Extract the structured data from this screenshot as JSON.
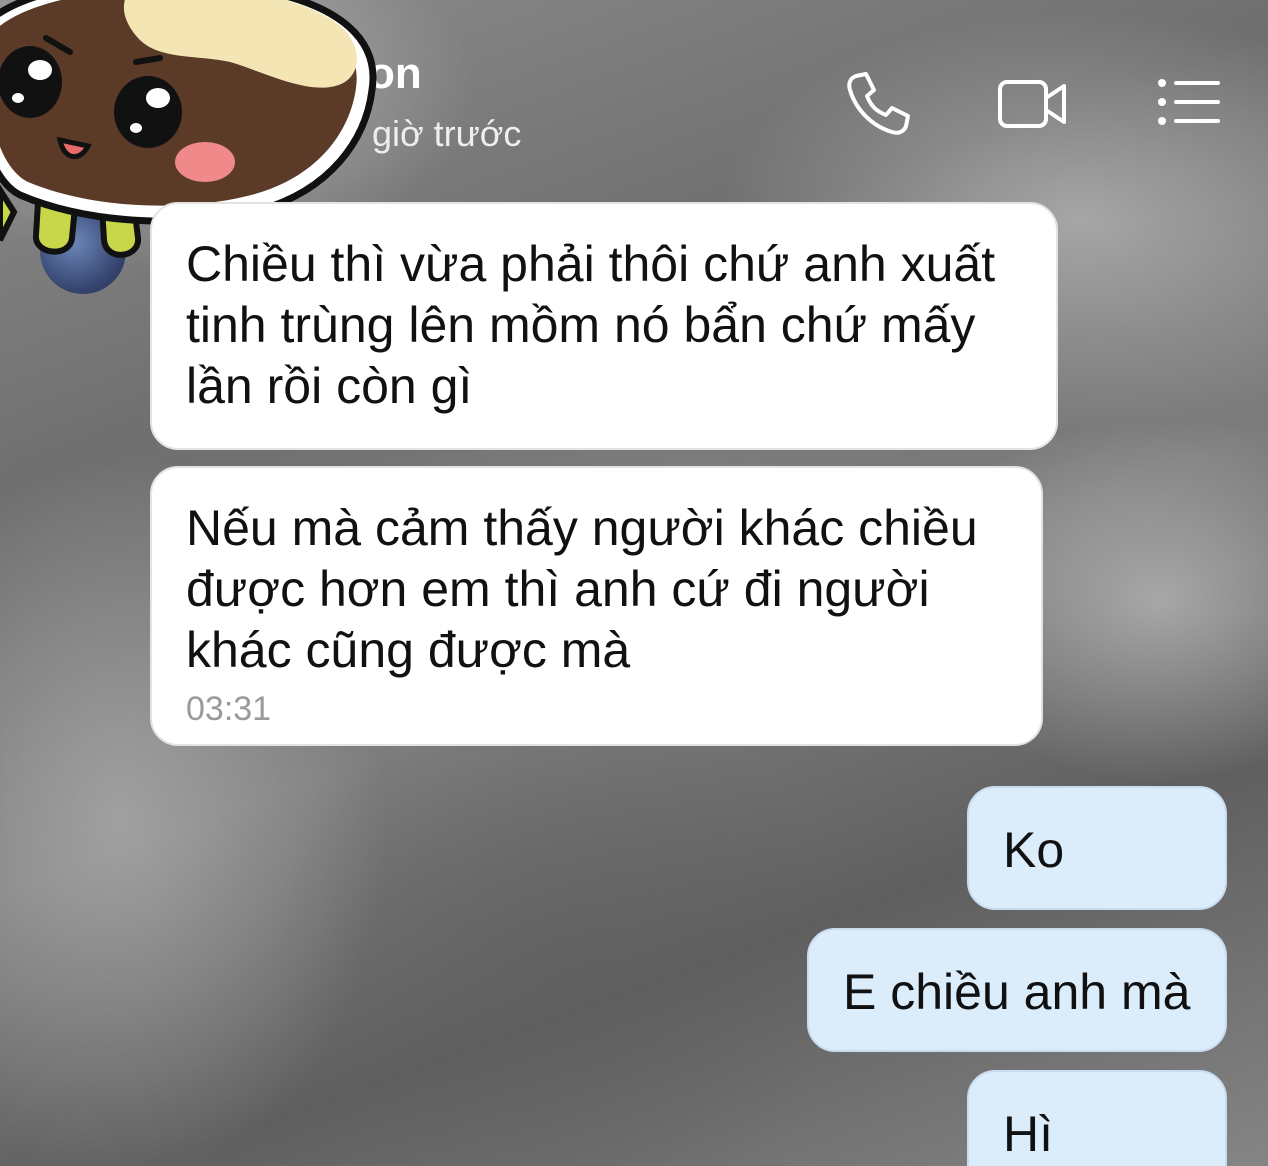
{
  "header": {
    "contact_name_visible": "on",
    "last_seen_visible": "giờ trước",
    "icons": {
      "call": "phone-icon",
      "video": "video-camera-icon",
      "menu": "list-menu-icon"
    }
  },
  "messages": [
    {
      "direction": "received",
      "text": "Chiều thì vừa phải thôi chứ anh xuất tinh trùng lên mồm nó bẩn chứ mấy lần rồi còn gì"
    },
    {
      "direction": "received",
      "text": "Nếu mà cảm thấy người khác chiều được hơn em thì anh cứ đi người khác cũng được mà",
      "time": "03:31"
    },
    {
      "direction": "sent",
      "text": "Ko"
    },
    {
      "direction": "sent",
      "text": "E chiều anh mà"
    },
    {
      "direction": "sent",
      "text": "Hì"
    }
  ],
  "colors": {
    "received_bubble": "#ffffff",
    "sent_bubble": "#dbecfb",
    "message_text": "#111111",
    "timestamp": "#9a9a9a",
    "header_text": "#ffffff"
  }
}
